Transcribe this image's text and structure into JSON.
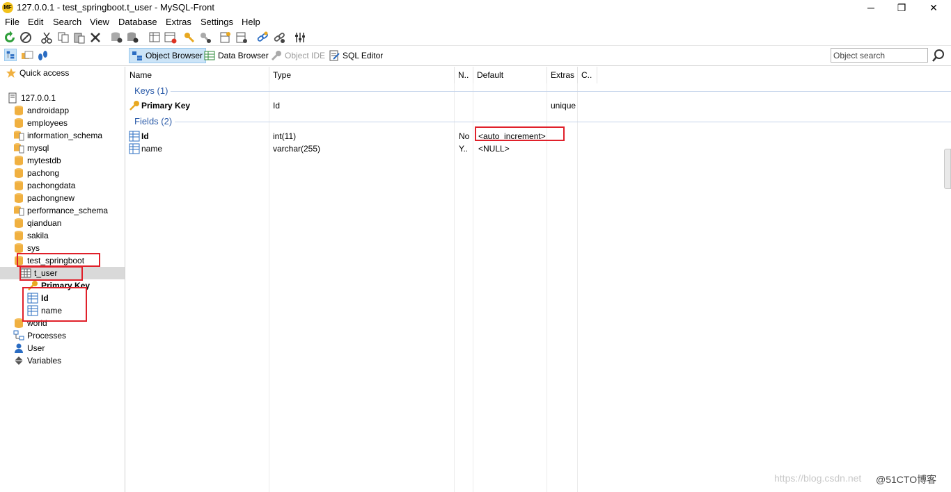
{
  "window": {
    "logo_text": "MF",
    "title": "127.0.0.1 - test_springboot.t_user - MySQL-Front",
    "minimize": "─",
    "restore": "❐",
    "close": "✕"
  },
  "menu": [
    "File",
    "Edit",
    "Search",
    "View",
    "Database",
    "Extras",
    "Settings",
    "Help"
  ],
  "view_tabs": {
    "object_browser": "Object Browser",
    "data_browser": "Data Browser",
    "object_ide": "Object IDE",
    "sql_editor": "SQL Editor"
  },
  "search": {
    "placeholder": "Object search"
  },
  "sidebar": {
    "quick_access": "Quick access",
    "host": "127.0.0.1",
    "databases": [
      "androidapp",
      "employees",
      "information_schema",
      "mysql",
      "mytestdb",
      "pachong",
      "pachongdata",
      "pachongnew",
      "performance_schema",
      "qianduan",
      "sakila",
      "sys",
      "test_springboot"
    ],
    "selected_table": "t_user",
    "primary_key": "Primary Key",
    "fields": [
      "Id",
      "name"
    ],
    "after_db": "world",
    "processes": "Processes",
    "user": "User",
    "variables": "Variables"
  },
  "grid": {
    "headers": {
      "name": "Name",
      "type": "Type",
      "null": "N..",
      "default": "Default",
      "extras": "Extras",
      "comment": "C.."
    },
    "keys_group": "Keys (1)",
    "fields_group": "Fields (2)",
    "key_row": {
      "name": "Primary Key",
      "type": "Id",
      "extras": "unique"
    },
    "field_rows": [
      {
        "name": "Id",
        "type": "int(11)",
        "null": "No",
        "default": "<auto_increment>"
      },
      {
        "name": "name",
        "type": "varchar(255)",
        "null": "Y..",
        "default": "<NULL>"
      }
    ]
  },
  "watermark": {
    "url": "https://blog.csdn.net",
    "brand": "@51CTO博客"
  },
  "colors": {
    "highlight_red": "#e0202a",
    "group_blue": "#2a5aa8",
    "db_icon": "#f0b040"
  }
}
